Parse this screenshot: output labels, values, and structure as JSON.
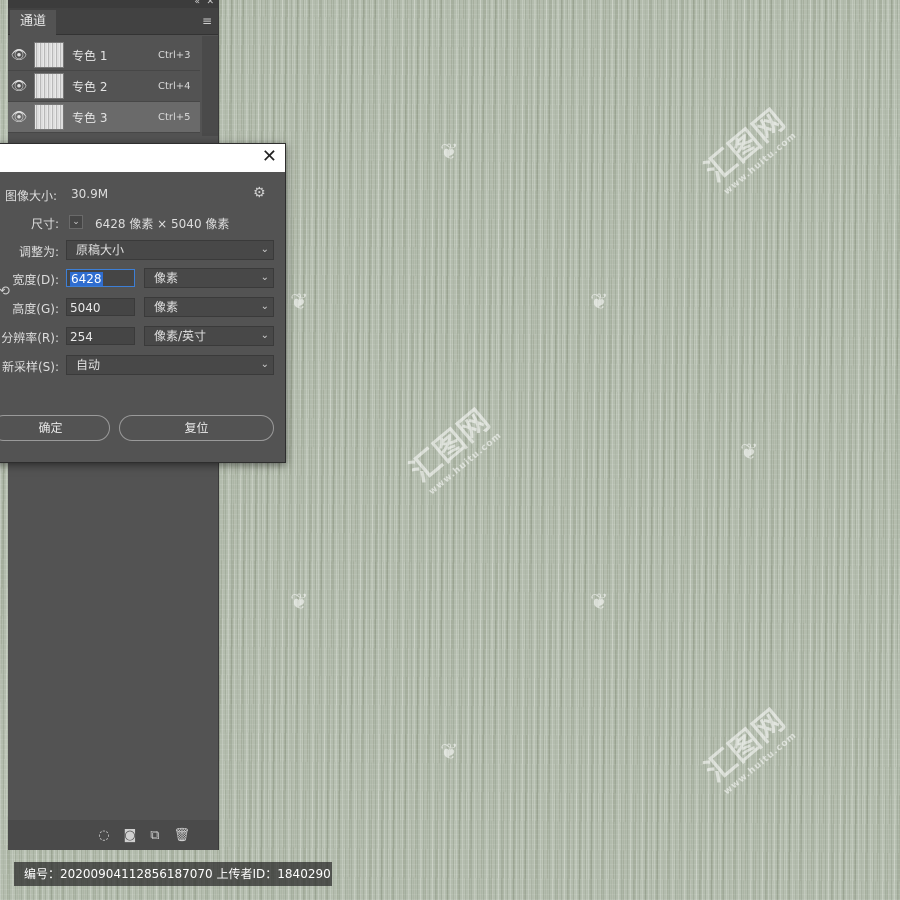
{
  "panel": {
    "tab_label": "通道",
    "collapse_icon": "«",
    "close_icon": "✕",
    "menu_icon": "≡",
    "channels": [
      {
        "name": "专色 1",
        "shortcut": "Ctrl+3"
      },
      {
        "name": "专色 2",
        "shortcut": "Ctrl+4"
      },
      {
        "name": "专色 3",
        "shortcut": "Ctrl+5"
      }
    ]
  },
  "dialog": {
    "image_size_label": "图像大小:",
    "image_size_value": "30.9M",
    "dimension_label": "尺寸:",
    "dimension_value": "6428 像素 × 5040 像素",
    "fit_label": "调整为:",
    "fit_value": "原稿大小",
    "width_label": "宽度(D):",
    "width_value": "6428",
    "width_unit": "像素",
    "height_label": "高度(G):",
    "height_value": "5040",
    "height_unit": "像素",
    "resolution_label": "分辨率(R):",
    "resolution_value": "254",
    "resolution_unit": "像素/英寸",
    "resample_label": "新采样(S):",
    "resample_value": "自动",
    "ok_label": "确定",
    "reset_label": "复位"
  },
  "footer": {
    "text": "编号：20200904112856187070 上传者ID：1840290"
  },
  "watermark": {
    "brand": "汇图网",
    "url": "www.huitu.com"
  },
  "colors": {
    "panel_bg": "#535353",
    "canvas": "#b3bcad",
    "focus": "#2f6dd0"
  }
}
